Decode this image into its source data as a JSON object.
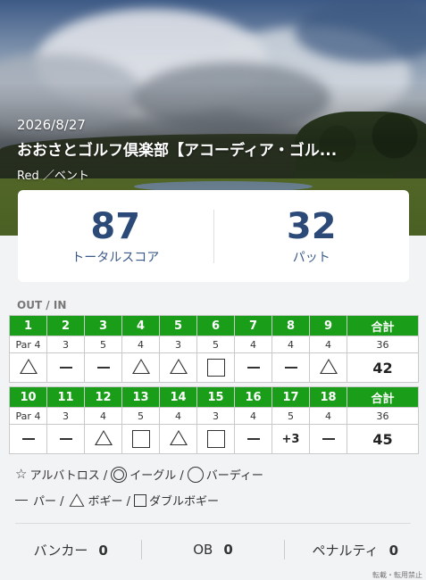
{
  "header": {
    "date": "2026/8/27",
    "course": "おおさとゴルフ倶楽部【アコーディア・ゴル...",
    "tee": "Red ／ベント"
  },
  "summary": {
    "total_score": "87",
    "total_label": "トータルスコア",
    "putts": "32",
    "putts_label": "パット"
  },
  "section_label": "OUT / IN",
  "out": {
    "holes": [
      "1",
      "2",
      "3",
      "4",
      "5",
      "6",
      "7",
      "8",
      "9"
    ],
    "total_label": "合計",
    "pars": [
      "Par 4",
      "3",
      "5",
      "4",
      "3",
      "5",
      "4",
      "4",
      "4"
    ],
    "par_total": "36",
    "results": [
      "triangle",
      "dash",
      "dash",
      "triangle",
      "triangle",
      "square",
      "dash",
      "dash",
      "triangle"
    ],
    "total": "42"
  },
  "in": {
    "holes": [
      "10",
      "11",
      "12",
      "13",
      "14",
      "15",
      "16",
      "17",
      "18"
    ],
    "total_label": "合計",
    "pars": [
      "Par 4",
      "3",
      "4",
      "5",
      "4",
      "3",
      "4",
      "5",
      "4"
    ],
    "par_total": "36",
    "results": [
      "dash",
      "dash",
      "triangle",
      "square",
      "triangle",
      "square",
      "dash",
      "+3",
      "dash"
    ],
    "total": "45"
  },
  "legend": {
    "albatross": "アルバトロス /",
    "eagle": "イーグル /",
    "birdie": "バーディー",
    "par": "パー /",
    "bogey": "ボギー /",
    "double_bogey": "ダブルボギー"
  },
  "stats": {
    "bunker_label": "バンカー",
    "bunker_value": "0",
    "ob_label": "OB",
    "ob_value": "0",
    "penalty_label": "ペナルティ",
    "penalty_value": "0"
  },
  "footnote": "転載・転用禁止",
  "colors": {
    "header_green": "#1a9e1a",
    "score_navy": "#2c4a78"
  }
}
